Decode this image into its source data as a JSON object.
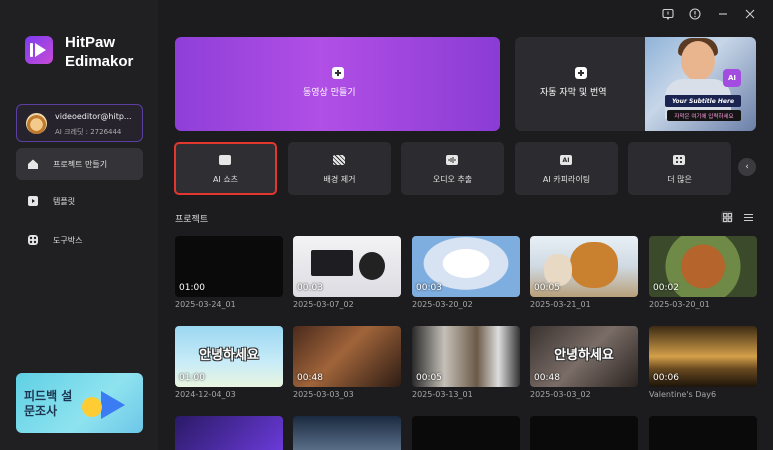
{
  "app": {
    "brand_line1": "HitPaw",
    "brand_line2": "Edimakor"
  },
  "account": {
    "name": "videoeditor@hitp...",
    "credits": "AI 크레딧 : 2726444"
  },
  "sidebar": {
    "items": [
      {
        "label": "프로젝트 만들기",
        "icon": "home-icon",
        "active": true
      },
      {
        "label": "템플릿",
        "icon": "template-icon",
        "active": false
      },
      {
        "label": "도구박스",
        "icon": "toolbox-icon",
        "active": false
      }
    ],
    "feedback_label": "피드백 설문조사"
  },
  "window_controls": [
    "feedback-icon",
    "info-icon",
    "minimize-icon",
    "close-icon"
  ],
  "hero": {
    "create_video_label": "동영상 만들기",
    "auto_subtitle_label": "자동 자막 및 번역",
    "subtitle_caption": "Your Subtitle Here",
    "subtitle_caption2": "자막은 여기에 입력하세요",
    "ai_badge": "AI"
  },
  "tools": [
    {
      "label": "AI 쇼츠",
      "icon": "ai-shorts-icon",
      "selected": true
    },
    {
      "label": "배경 제거",
      "icon": "background-remove-icon",
      "selected": false
    },
    {
      "label": "오디오 추출",
      "icon": "audio-extract-icon",
      "selected": false
    },
    {
      "label": "AI 카피라이팅",
      "icon": "ai-copywriting-icon",
      "selected": false
    },
    {
      "label": "더 많은",
      "icon": "more-icon",
      "selected": false
    }
  ],
  "projects": {
    "title": "프로젝트",
    "items": [
      {
        "name": "2025-03-24_01",
        "duration": "01:00"
      },
      {
        "name": "2025-03-07_02",
        "duration": "00:03"
      },
      {
        "name": "2025-03-20_02",
        "duration": "00:03"
      },
      {
        "name": "2025-03-21_01",
        "duration": "00:05"
      },
      {
        "name": "2025-03-20_01",
        "duration": "00:02"
      },
      {
        "name": "2024-12-04_03",
        "duration": "01:00",
        "overlay": "안녕하세요"
      },
      {
        "name": "2025-03-03_03",
        "duration": "00:48"
      },
      {
        "name": "2025-03-13_01",
        "duration": "00:05"
      },
      {
        "name": "2025-03-03_02",
        "duration": "00:48",
        "overlay": "안녕하세요"
      },
      {
        "name": "Valentine's Day6",
        "duration": "00:06"
      }
    ]
  },
  "colors": {
    "accent_purple": "#9b45dc",
    "selection_red": "#e3362f",
    "background": "#1c1c1f",
    "sidebar": "#202023"
  }
}
